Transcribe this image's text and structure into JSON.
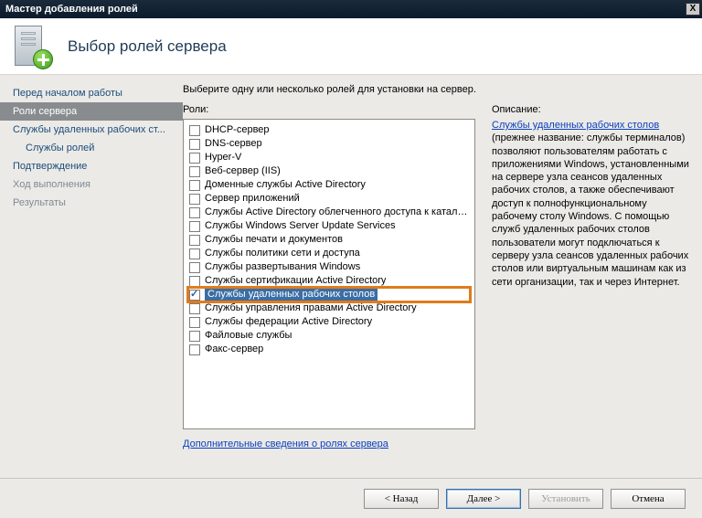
{
  "window": {
    "title": "Мастер добавления ролей"
  },
  "header": {
    "title": "Выбор ролей сервера"
  },
  "sidebar": {
    "steps": [
      {
        "label": "Перед началом работы",
        "dim": false,
        "sub": false
      },
      {
        "label": "Роли сервера",
        "active": true,
        "sub": false
      },
      {
        "label": "Службы удаленных рабочих ст...",
        "sub": false
      },
      {
        "label": "Службы ролей",
        "sub": true
      },
      {
        "label": "Подтверждение",
        "sub": false
      },
      {
        "label": "Ход выполнения",
        "dim": true,
        "sub": false
      },
      {
        "label": "Результаты",
        "dim": true,
        "sub": false
      }
    ]
  },
  "main": {
    "prompt": "Выберите одну или несколько ролей для установки на сервер.",
    "roles_label": "Роли:",
    "desc_label": "Описание:",
    "roles": [
      {
        "label": "DHCP-сервер",
        "checked": false
      },
      {
        "label": "DNS-сервер",
        "checked": false
      },
      {
        "label": "Hyper-V",
        "checked": false
      },
      {
        "label": "Веб-сервер (IIS)",
        "checked": false
      },
      {
        "label": "Доменные службы Active Directory",
        "checked": false
      },
      {
        "label": "Сервер приложений",
        "checked": false
      },
      {
        "label": "Службы Active Directory облегченного доступа к каталогам",
        "checked": false
      },
      {
        "label": "Службы Windows Server Update Services",
        "checked": false
      },
      {
        "label": "Службы печати и документов",
        "checked": false
      },
      {
        "label": "Службы политики сети и доступа",
        "checked": false
      },
      {
        "label": "Службы развертывания Windows",
        "checked": false
      },
      {
        "label": "Службы сертификации Active Directory",
        "checked": false
      },
      {
        "label": "Службы удаленных рабочих столов",
        "checked": true,
        "highlight": true
      },
      {
        "label": "Службы управления правами Active Directory",
        "checked": false
      },
      {
        "label": "Службы федерации Active Directory",
        "checked": false
      },
      {
        "label": "Файловые службы",
        "checked": false
      },
      {
        "label": "Факс-сервер",
        "checked": false
      }
    ],
    "desc_link": "Службы удаленных рабочих столов",
    "desc_body": " (прежнее название: службы терминалов) позволяют пользователям работать с приложениями Windows, установленными на сервере узла сеансов удаленных рабочих столов, а также обеспечивают доступ к полнофункциональному рабочему столу Windows. С помощью служб удаленных рабочих столов пользователи могут подключаться к серверу узла сеансов удаленных рабочих столов или виртуальным машинам как из сети организации, так и через Интернет.",
    "more_info": "Дополнительные сведения о ролях сервера"
  },
  "footer": {
    "back": "< Назад",
    "next": "Далее >",
    "install": "Установить",
    "cancel": "Отмена"
  }
}
